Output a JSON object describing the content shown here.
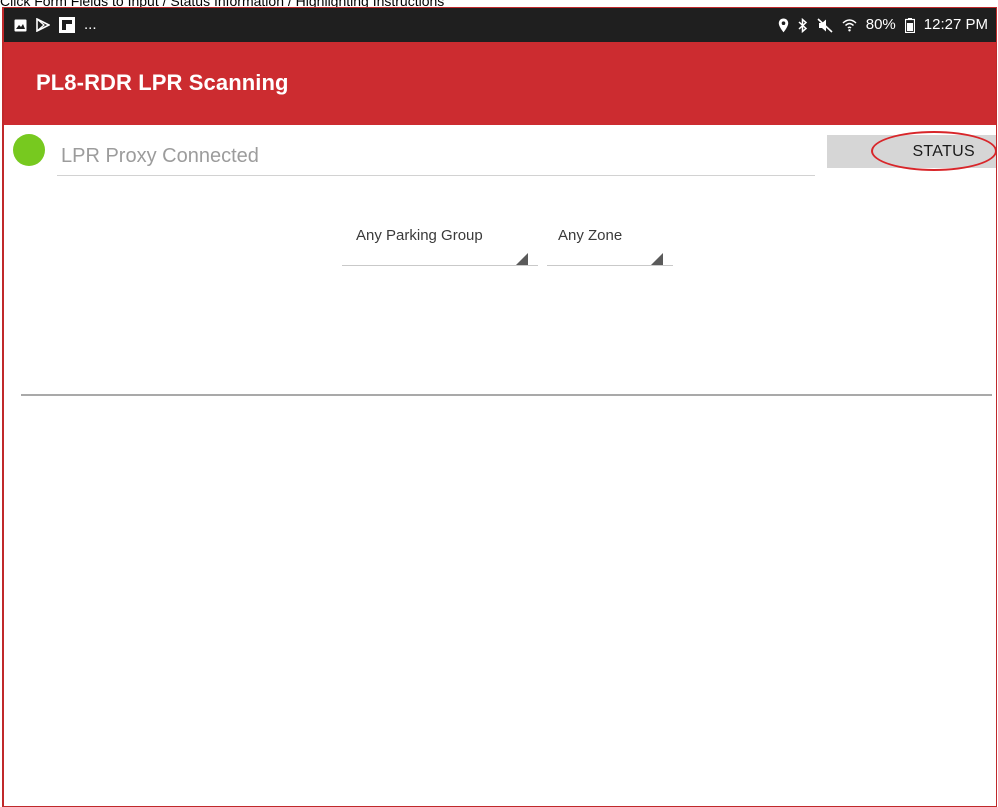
{
  "caption": "Click Form Fields to Input / Status Information / Highlighting Instructions",
  "status_bar": {
    "icons_left": [
      "image-notification-icon",
      "play-store-icon",
      "flipboard-icon"
    ],
    "more": "...",
    "icons_right": [
      "location-icon",
      "bluetooth-icon",
      "mute-icon",
      "wifi-icon"
    ],
    "battery_text": "80%",
    "time": "12:27 PM"
  },
  "app_bar": {
    "title": "PL8-RDR LPR Scanning"
  },
  "connection": {
    "status_text": "LPR Proxy Connected",
    "indicator_color": "#77c91f"
  },
  "status_button": {
    "label": "STATUS"
  },
  "filters": {
    "parking_group": {
      "selected": "Any Parking Group"
    },
    "zone": {
      "selected": "Any Zone"
    }
  },
  "colors": {
    "accent": "#cc2c30",
    "highlight_oval": "#d8262a"
  }
}
